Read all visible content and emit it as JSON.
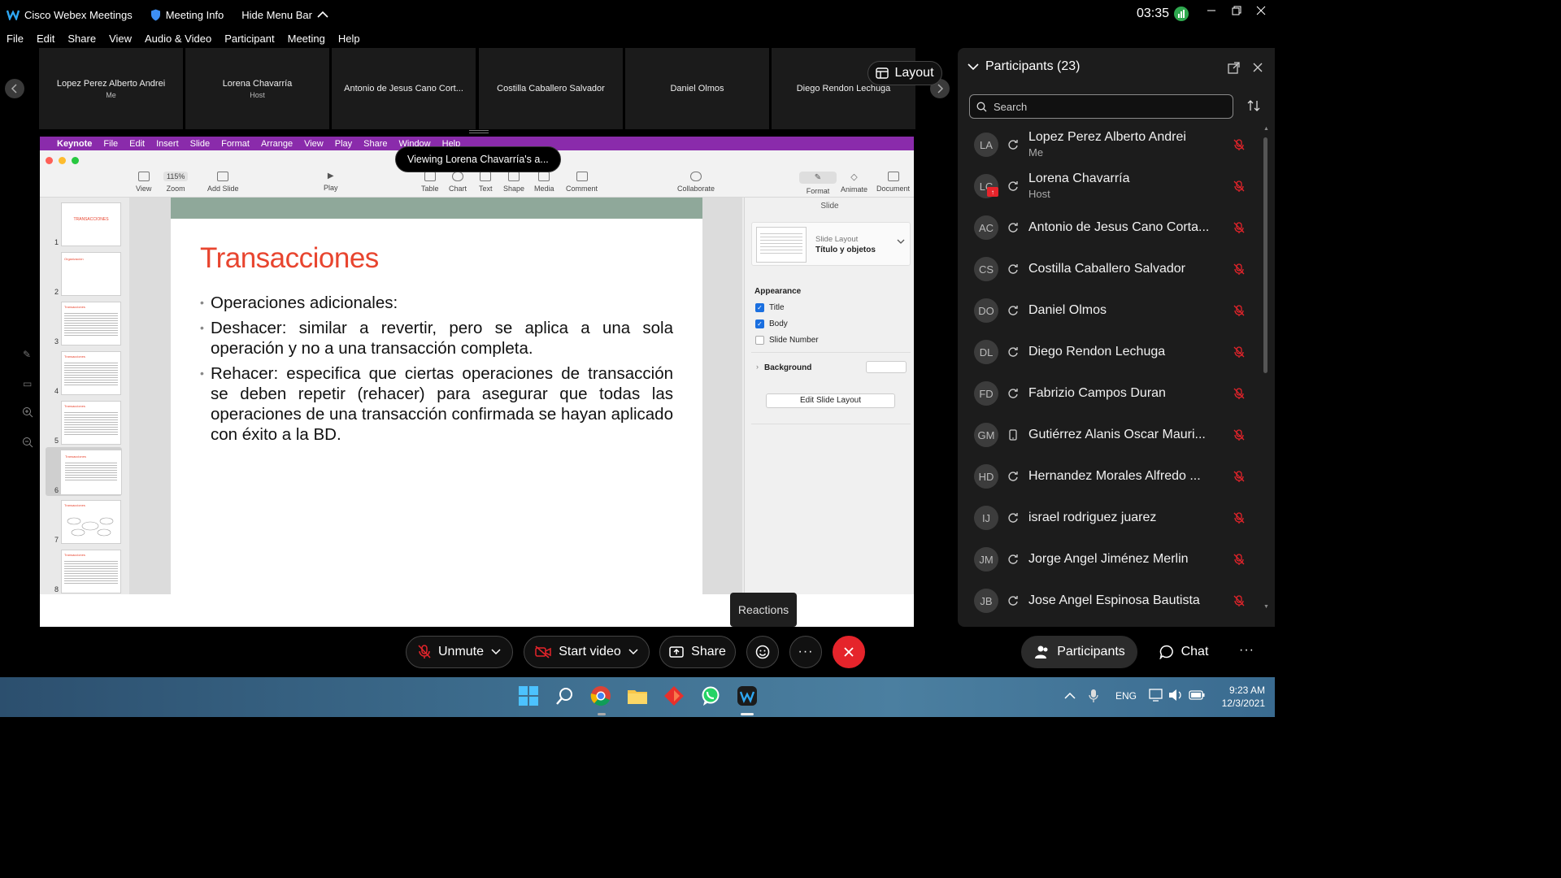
{
  "window": {
    "app_title": "Cisco Webex Meetings",
    "meeting_info": "Meeting Info",
    "hide_menu": "Hide Menu Bar",
    "time": "03:35"
  },
  "menu": [
    "File",
    "Edit",
    "Share",
    "View",
    "Audio & Video",
    "Participant",
    "Meeting",
    "Help"
  ],
  "video_strip": [
    {
      "name": "Lopez Perez Alberto Andrei",
      "sub": "Me"
    },
    {
      "name": "Lorena Chavarría",
      "sub": "Host"
    },
    {
      "name": "Antonio de Jesus Cano Cort...",
      "sub": ""
    },
    {
      "name": "Costilla Caballero Salvador",
      "sub": ""
    },
    {
      "name": "Daniel Olmos",
      "sub": ""
    },
    {
      "name": "Diego Rendon Lechuga",
      "sub": ""
    }
  ],
  "layout_label": "Layout",
  "viewing_banner": "Viewing Lorena Chavarría's a...",
  "keynote": {
    "menu": [
      "Keynote",
      "File",
      "Edit",
      "Insert",
      "Slide",
      "Format",
      "Arrange",
      "View",
      "Play",
      "Share",
      "Window",
      "Help"
    ],
    "toolbar": {
      "view": "View",
      "zoom_value": "115%",
      "zoom": "Zoom",
      "add_slide": "Add Slide",
      "play": "Play",
      "table": "Table",
      "chart": "Chart",
      "text": "Text",
      "shape": "Shape",
      "media": "Media",
      "comment": "Comment",
      "collaborate": "Collaborate",
      "format": "Format",
      "animate": "Animate",
      "document": "Document"
    },
    "slide_numbers": [
      "1",
      "2",
      "3",
      "4",
      "5",
      "6",
      "7",
      "8"
    ],
    "thumb_titles": [
      "TRANSACCIONES",
      "Organización",
      "Transacciones",
      "Transacciones",
      "Transacciones",
      "Transacciones",
      "Transacciones",
      "Transacciones"
    ],
    "slide": {
      "title": "Transacciones",
      "bullets": [
        "Operaciones adicionales:",
        "Deshacer: similar a revertir, pero se aplica a una sola operación y no a una transacción completa.",
        "Rehacer: especifica que ciertas operaciones de transacción se deben repetir (rehacer) para asegurar que todas las operaciones de una transacción confirmada se hayan aplicado con éxito a la BD."
      ]
    },
    "inspector": {
      "tab": "Slide",
      "layout_label": "Slide Layout",
      "layout_value": "Título y objetos",
      "appearance": "Appearance",
      "title_cb": "Title",
      "body_cb": "Body",
      "slide_number_cb": "Slide Number",
      "background": "Background",
      "edit_layout": "Edit Slide Layout"
    }
  },
  "reactions_tooltip": "Reactions",
  "participants_panel": {
    "title": "Participants (23)",
    "search_placeholder": "Search",
    "people": [
      {
        "initials": "LA",
        "name": "Lopez Perez Alberto Andrei",
        "sub": "Me",
        "device": "sync"
      },
      {
        "initials": "LC",
        "name": "Lorena Chavarría",
        "sub": "Host",
        "device": "sync"
      },
      {
        "initials": "AC",
        "name": "Antonio de Jesus Cano Corta...",
        "sub": "",
        "device": "sync"
      },
      {
        "initials": "CS",
        "name": "Costilla Caballero Salvador",
        "sub": "",
        "device": "sync"
      },
      {
        "initials": "DO",
        "name": "Daniel Olmos",
        "sub": "",
        "device": "sync"
      },
      {
        "initials": "DL",
        "name": "Diego Rendon Lechuga",
        "sub": "",
        "device": "sync"
      },
      {
        "initials": "FD",
        "name": "Fabrizio Campos Duran",
        "sub": "",
        "device": "sync"
      },
      {
        "initials": "GM",
        "name": "Gutiérrez Alanis Oscar Mauri...",
        "sub": "",
        "device": "phone"
      },
      {
        "initials": "HD",
        "name": "Hernandez Morales Alfredo ...",
        "sub": "",
        "device": "sync"
      },
      {
        "initials": "IJ",
        "name": "israel rodriguez juarez",
        "sub": "",
        "device": "sync"
      },
      {
        "initials": "JM",
        "name": "Jorge Angel Jiménez Merlin",
        "sub": "",
        "device": "sync"
      },
      {
        "initials": "JB",
        "name": "Jose Angel Espinosa Bautista",
        "sub": "",
        "device": "sync"
      }
    ]
  },
  "controls": {
    "unmute": "Unmute",
    "start_video": "Start video",
    "share": "Share",
    "participants": "Participants",
    "chat": "Chat"
  },
  "taskbar": {
    "lang": "ENG",
    "time": "9:23 AM",
    "date": "12/3/2021"
  },
  "colors": {
    "keynote_menu": "#8a2bab",
    "slide_title": "#e8452f",
    "end_call": "#e5242b",
    "checkbox": "#1a6fe0"
  }
}
